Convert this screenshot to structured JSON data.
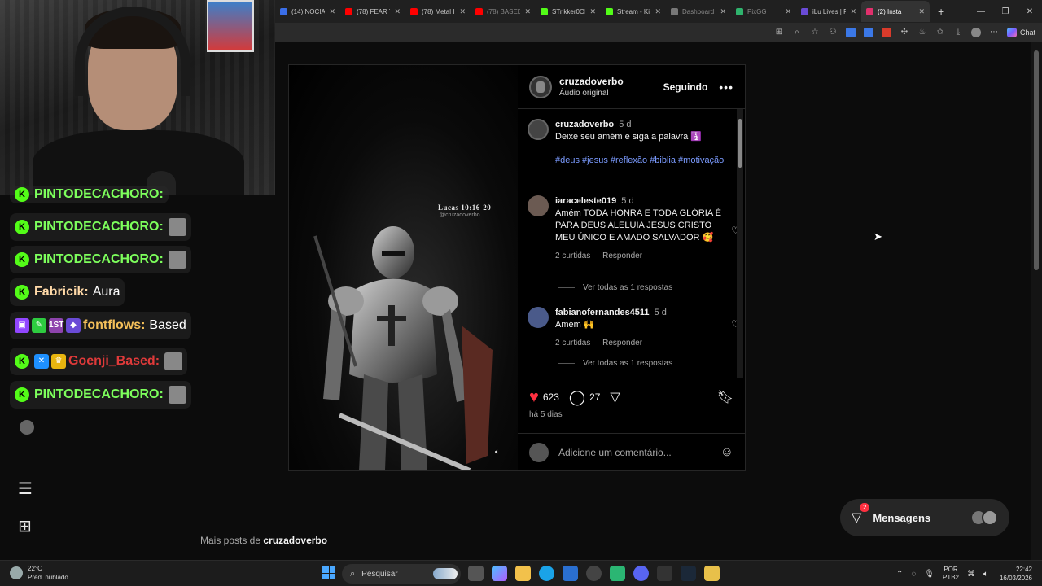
{
  "browser": {
    "tabs": [
      {
        "label": "(14) NOCIA",
        "favcolor": "#3a6ee8",
        "active": false
      },
      {
        "label": "(78) FEAR T",
        "favcolor": "#ff0000",
        "active": false
      },
      {
        "label": "(78) Metal I",
        "favcolor": "#ff0000",
        "active": false
      },
      {
        "label": "(78) BASED",
        "favcolor": "#ff0000",
        "active": false,
        "dim": true
      },
      {
        "label": "STrikker0OF",
        "favcolor": "#53fc18",
        "active": false
      },
      {
        "label": "Stream - Ki",
        "favcolor": "#53fc18",
        "active": false
      },
      {
        "label": "Dashboard",
        "favcolor": "#777777",
        "active": false,
        "dim": true
      },
      {
        "label": "PixGG",
        "favcolor": "#2fb36d",
        "active": false,
        "dim": true
      },
      {
        "label": "iLu Lives | R",
        "favcolor": "#6a4bd6",
        "active": false
      },
      {
        "label": "(2) Insta",
        "favcolor": "#e1306c",
        "active": true
      }
    ],
    "copilot_label": "Chat"
  },
  "post": {
    "author": "cruzadoverbo",
    "audio": "Áudio original",
    "follow_label": "Seguindo",
    "more_label": "•••",
    "media_verse": "Lucas 10:16-20",
    "media_handle": "@cruzadoverbo",
    "caption": {
      "user": "cruzadoverbo",
      "time": "5 d",
      "text": "Deixe seu amém e siga a palavra 🛐",
      "tags": "#deus #jesus #reflexão #biblia #motivação"
    },
    "comments": [
      {
        "user": "iaraceleste019",
        "time": "5 d",
        "text": "Amém TODA HONRA E TODA GLÓRIA É PARA DEUS ALELUIA JESUS CRISTO MEU ÚNICO E AMADO SALVADOR 🥰",
        "likes": "2 curtidas",
        "reply": "Responder",
        "replies": "Ver todas as 1 respostas"
      },
      {
        "user": "fabianofernandes4511",
        "time": "5 d",
        "text": "Amém 🙌",
        "likes": "2 curtidas",
        "reply": "Responder",
        "replies": "Ver todas as 1 respostas"
      }
    ],
    "like_count": "623",
    "comment_count": "27",
    "date": "há 5 dias",
    "add_comment_placeholder": "Adicione um comentário..."
  },
  "more_posts": {
    "prefix": "Mais posts de",
    "user": "cruzadoverbo"
  },
  "messages": {
    "label": "Mensagens",
    "badge": "2"
  },
  "stream_chat": [
    {
      "user": "PINTODECACHORO:",
      "color": "#7dff5c",
      "msg": "",
      "badges": [
        "kick"
      ]
    },
    {
      "user": "PINTODECACHORO:",
      "color": "#7dff5c",
      "msg": "",
      "badges": [
        "kick"
      ]
    },
    {
      "user": "Fabricik:",
      "color": "#ffd9a8",
      "msg": "Aura",
      "badges": [
        "kick"
      ]
    },
    {
      "user": "fontflows:",
      "color": "#f5c05a",
      "msg": "Based",
      "badges": [
        "twitch",
        "green",
        "1st",
        "diamond"
      ]
    },
    {
      "user": "Goenji_Based:",
      "color": "#e03a3a",
      "msg": "",
      "badges": [
        "kick",
        "blue",
        "crown"
      ]
    },
    {
      "user": "PINTODECACHORO:",
      "color": "#7dff5c",
      "msg": "",
      "badges": [
        "kick"
      ]
    }
  ],
  "partial_top_line": "PINTODECACHORO:",
  "badge_texts": {
    "1st": "1ST"
  },
  "taskbar": {
    "temp": "22°C",
    "weather": "Pred. nublado",
    "search": "Pesquisar",
    "lang_top": "POR",
    "lang_bottom": "PTB2",
    "time": "22:42",
    "date": "16/03/2026"
  }
}
